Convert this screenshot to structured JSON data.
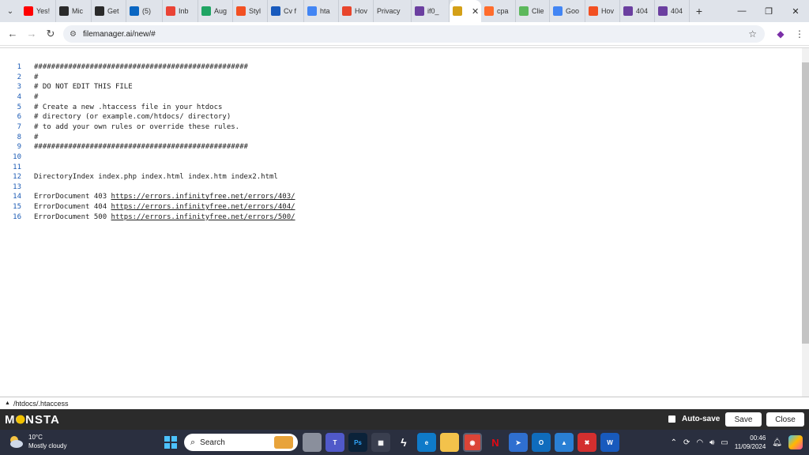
{
  "browser": {
    "tabs": [
      {
        "label": "Yes!",
        "icon": "youtube-icon",
        "color": "#ff0000"
      },
      {
        "label": "Mic",
        "icon": "grammarly-icon",
        "color": "#2a2a2a"
      },
      {
        "label": "Get",
        "icon": "grammarly-icon",
        "color": "#2a2a2a"
      },
      {
        "label": "(5)",
        "icon": "linkedin-icon",
        "color": "#0a66c2"
      },
      {
        "label": "Inb",
        "icon": "gmail-icon",
        "color": "#ea4335"
      },
      {
        "label": "Aug",
        "icon": "drive-icon",
        "color": "#1fa463"
      },
      {
        "label": "Styl",
        "icon": "microsoft-icon",
        "color": "#f25022"
      },
      {
        "label": "Cv f",
        "icon": "word-icon",
        "color": "#185abd"
      },
      {
        "label": "hta",
        "icon": "google-icon",
        "color": "#4285f4"
      },
      {
        "label": "Hov",
        "icon": "app-icon",
        "color": "#e8452c"
      },
      {
        "label": "Privacy",
        "icon": "",
        "color": ""
      },
      {
        "label": "if0_",
        "icon": "infinity-icon",
        "color": "#6b3fa0"
      },
      {
        "label": "",
        "icon": "filemanager-icon",
        "color": "#d4a017",
        "active": true
      },
      {
        "label": "cpa",
        "icon": "cpanel-icon",
        "color": "#ff6c2c"
      },
      {
        "label": "Clie",
        "icon": "app-icon",
        "color": "#5cb85c"
      },
      {
        "label": "Goo",
        "icon": "translate-icon",
        "color": "#4285f4"
      },
      {
        "label": "Hov",
        "icon": "microsoft-icon",
        "color": "#f25022"
      },
      {
        "label": "404",
        "icon": "infinity-icon",
        "color": "#6b3fa0"
      },
      {
        "label": "404",
        "icon": "infinity-icon",
        "color": "#6b3fa0"
      }
    ],
    "url": "filemanager.ai/new/#"
  },
  "editor": {
    "lines": [
      {
        "n": "1",
        "text": "##################################################"
      },
      {
        "n": "2",
        "text": "#"
      },
      {
        "n": "3",
        "text": "# DO NOT EDIT THIS FILE"
      },
      {
        "n": "4",
        "text": "#"
      },
      {
        "n": "5",
        "text": "# Create a new .htaccess file in your htdocs"
      },
      {
        "n": "6",
        "text": "# directory (or example.com/htdocs/ directory)"
      },
      {
        "n": "7",
        "text": "# to add your own rules or override these rules."
      },
      {
        "n": "8",
        "text": "#"
      },
      {
        "n": "9",
        "text": "##################################################"
      },
      {
        "n": "10",
        "text": ""
      },
      {
        "n": "11",
        "text": ""
      },
      {
        "n": "12",
        "text": "DirectoryIndex index.php index.html index.htm index2.html"
      },
      {
        "n": "13",
        "text": ""
      },
      {
        "n": "14",
        "text": "ErrorDocument 403 ",
        "link": "https://errors.infinityfree.net/errors/403/"
      },
      {
        "n": "15",
        "text": "ErrorDocument 404 ",
        "link": "https://errors.infinityfree.net/errors/404/"
      },
      {
        "n": "16",
        "text": "ErrorDocument 500 ",
        "link": "https://errors.infinityfree.net/errors/500/"
      }
    ]
  },
  "status": {
    "path": "/htdocs/.htaccess"
  },
  "app": {
    "logo": "MONSTA",
    "autosave_label": "Auto-save",
    "save_label": "Save",
    "close_label": "Close"
  },
  "taskbar": {
    "temp": "10°C",
    "weather": "Mostly cloudy",
    "search_placeholder": "Search",
    "time": "00:46",
    "date": "11/09/2024"
  }
}
